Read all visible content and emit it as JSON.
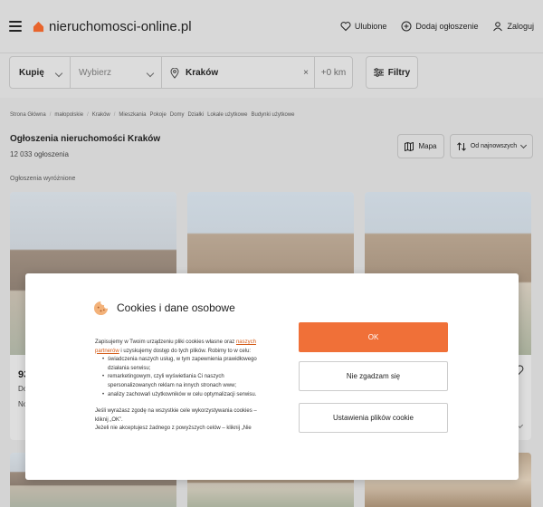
{
  "header": {
    "logo_text": "nieruchomosci-online.pl",
    "favorites": "Ulubione",
    "add_listing": "Dodaj ogłoszenie",
    "login": "Zaloguj",
    "accent": "#e8642c"
  },
  "search": {
    "type": "Kupię",
    "category_placeholder": "Wybierz",
    "location": "Kraków",
    "clear": "×",
    "radius": "+0 km",
    "filters": "Filtry"
  },
  "breadcrumbs": [
    "Strona Główna",
    "małopolskie",
    "Kraków",
    "Mieszkania",
    "Pokoje",
    "Domy",
    "Działki",
    "Lokale użytkowe",
    "Budynki użytkowe"
  ],
  "main": {
    "title": "Ogłoszenia nieruchomości Kraków",
    "count": "12 033 ogłoszenia",
    "map_label": "Mapa",
    "sort_label": "Od najnowszych",
    "featured_label": "Ogłoszenia wyróżnione"
  },
  "cards": [
    {
      "price_partial": "93",
      "line1_partial": "Do",
      "line2_partial": "No"
    }
  ],
  "modal": {
    "title": "Cookies i dane osobowe",
    "intro_1": "Zapisujemy w Twoim urządzeniu pliki cookies własne oraz ",
    "intro_link": "naszych partnerów",
    "intro_2": " i uzyskujemy dostęp do tych plików. Robimy to w celu:",
    "bullets": [
      "świadczenia naszych usług, w tym zapewnienia prawidłowego działania serwisu;",
      "remarketingowym, czyli wyświetlania Ci naszych spersonalizowanych reklam na innych stronach www;",
      "analizy zachowań użytkowników w celu optymalizacji serwisu."
    ],
    "consent": "Jeśli wyrażasz zgodę na wszystkie cele wykorzystywania cookies – kliknij „OK”.",
    "reject_info": "Jeżeli nie akceptujesz żadnego z powyższych celów – kliknij „Nie",
    "ok_button": "OK",
    "reject_button": "Nie zgadzam się",
    "settings_button": "Ustawienia plików cookie",
    "ok_color": "#f07038"
  }
}
